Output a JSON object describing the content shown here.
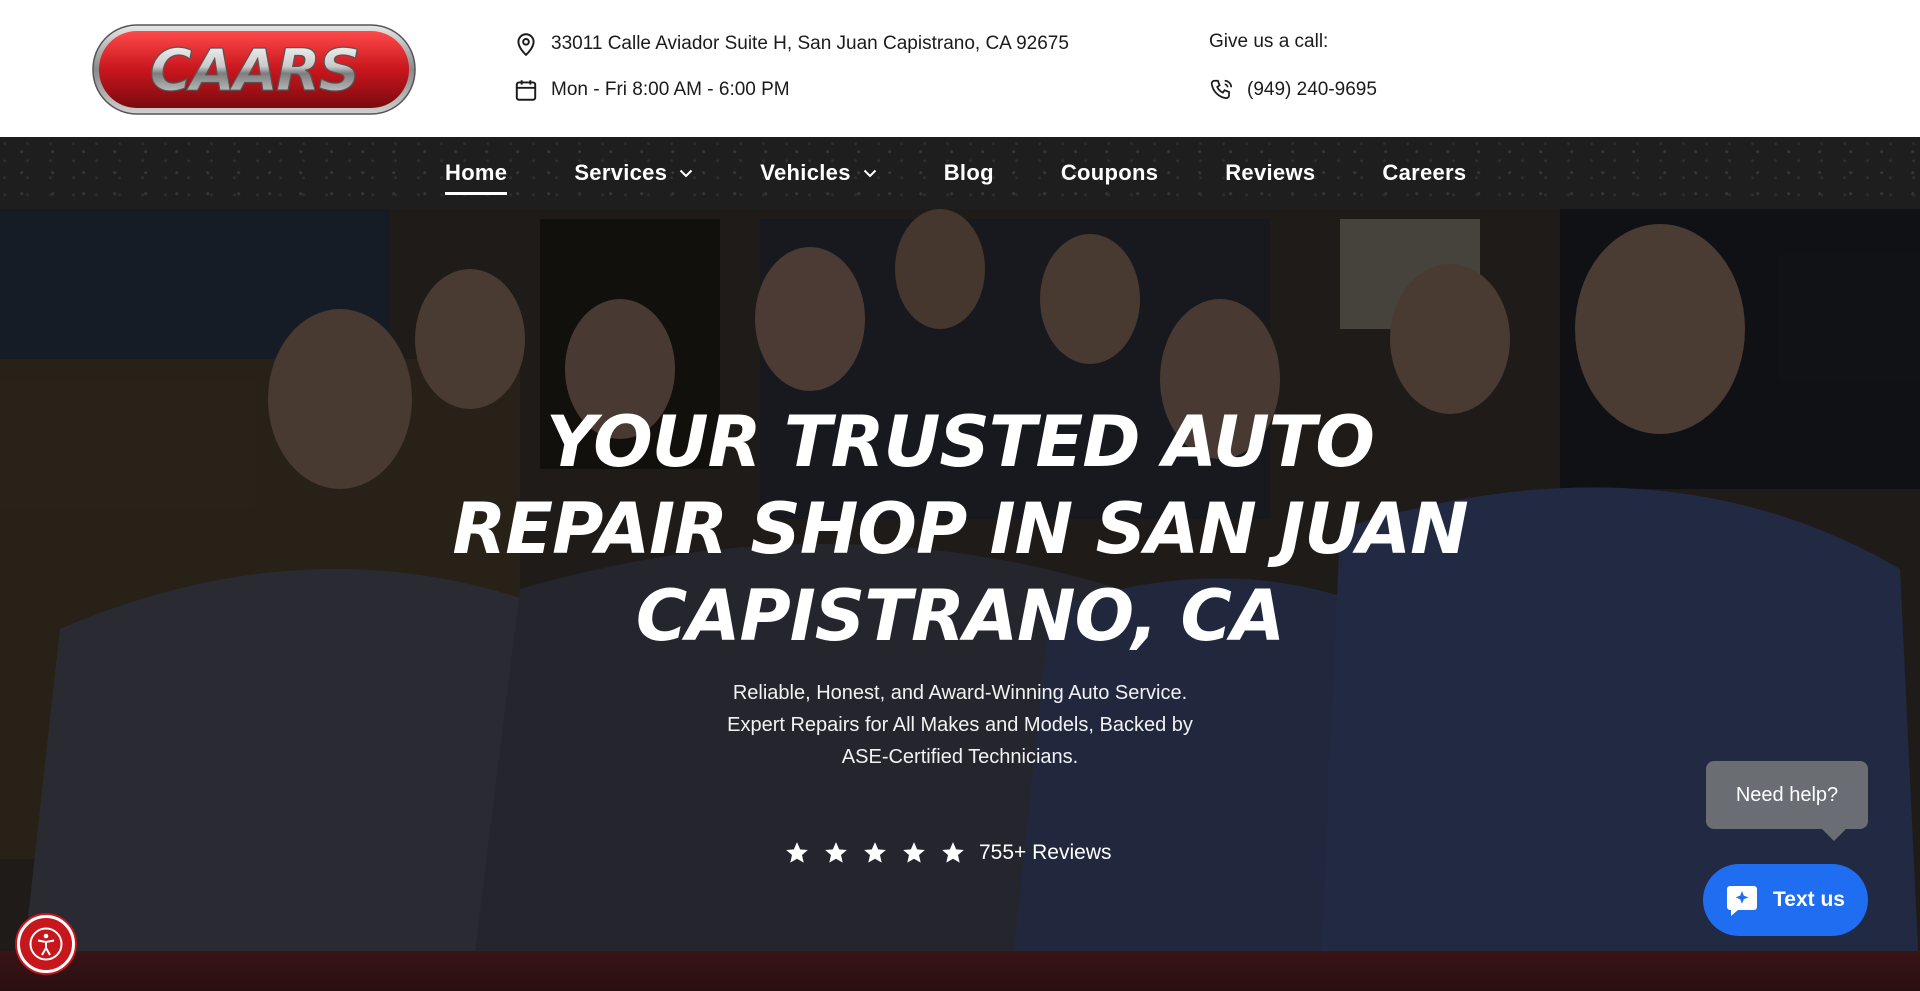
{
  "header": {
    "logo_text": "CAARS",
    "address": "33011 Calle Aviador Suite H, San Juan Capistrano, CA 92675",
    "hours": "Mon - Fri 8:00 AM - 6:00 PM",
    "call_label": "Give us a call:",
    "phone": "(949) 240-9695"
  },
  "nav": {
    "items": [
      {
        "label": "Home",
        "active": true
      },
      {
        "label": "Services",
        "dropdown": true
      },
      {
        "label": "Vehicles",
        "dropdown": true
      },
      {
        "label": "Blog"
      },
      {
        "label": "Coupons"
      },
      {
        "label": "Reviews"
      },
      {
        "label": "Careers"
      }
    ]
  },
  "hero": {
    "title_line1": "YOUR TRUSTED AUTO",
    "title_line2": "REPAIR SHOP IN SAN JUAN",
    "title_line3": "CAPISTRANO, CA",
    "sub_line1": "Reliable, Honest, and Award-Winning Auto Service.",
    "sub_line2": "Expert Repairs for All Makes and Models, Backed by",
    "sub_line3": "ASE-Certified Technicians.",
    "stars": 5,
    "reviews": "755+ Reviews"
  },
  "widgets": {
    "help_text": "Need help?",
    "text_us_label": "Text us"
  },
  "colors": {
    "brand_red": "#c8161d",
    "chat_blue": "#1f6df0",
    "nav_bg": "#1e1e1e"
  },
  "icons": [
    "map-pin-icon",
    "calendar-icon",
    "phone-icon",
    "chevron-down-icon",
    "star-icon",
    "chat-icon",
    "accessibility-icon"
  ]
}
